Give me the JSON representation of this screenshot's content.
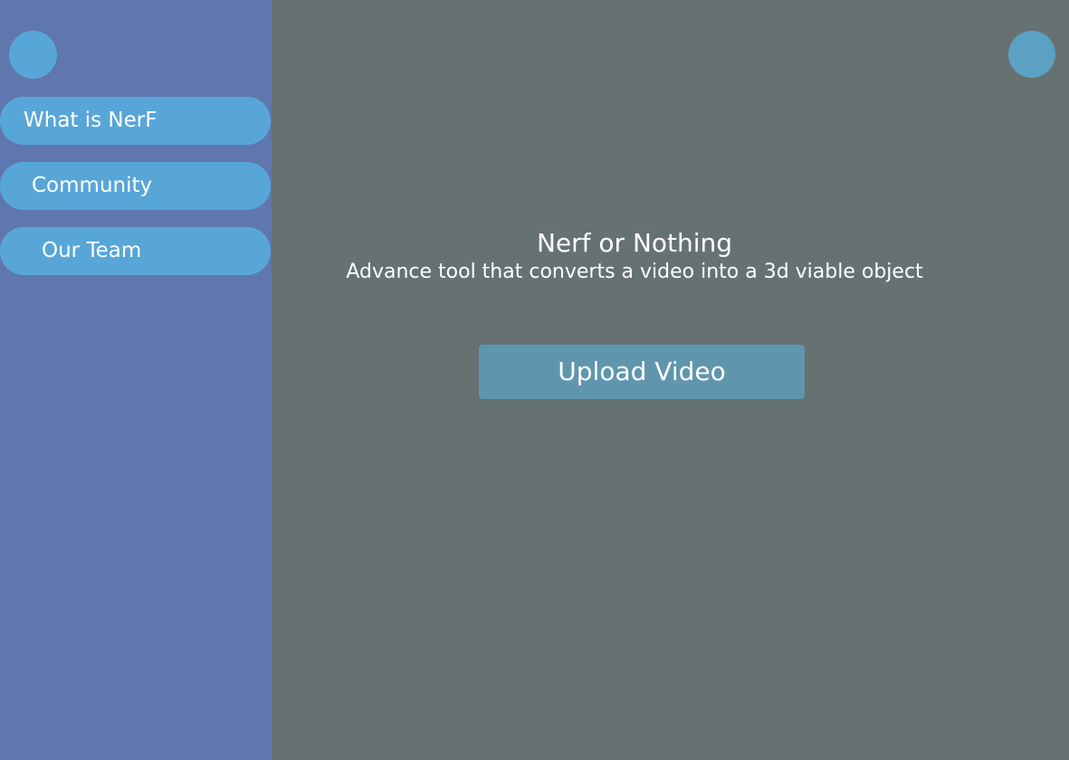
{
  "sidebar": {
    "items": [
      {
        "label": "What is NerF"
      },
      {
        "label": "Community"
      },
      {
        "label": "Our Team"
      }
    ]
  },
  "main": {
    "title": "Nerf or Nothing",
    "subtitle": "Advance tool that converts a video into a 3d viable object",
    "upload_label": "Upload Video"
  },
  "colors": {
    "sidebar_background": "#5f77ad",
    "main_background": "#667172",
    "nav_pill": "#58a6d8",
    "upload_button": "#5f96ae",
    "text": "#ffffff"
  }
}
